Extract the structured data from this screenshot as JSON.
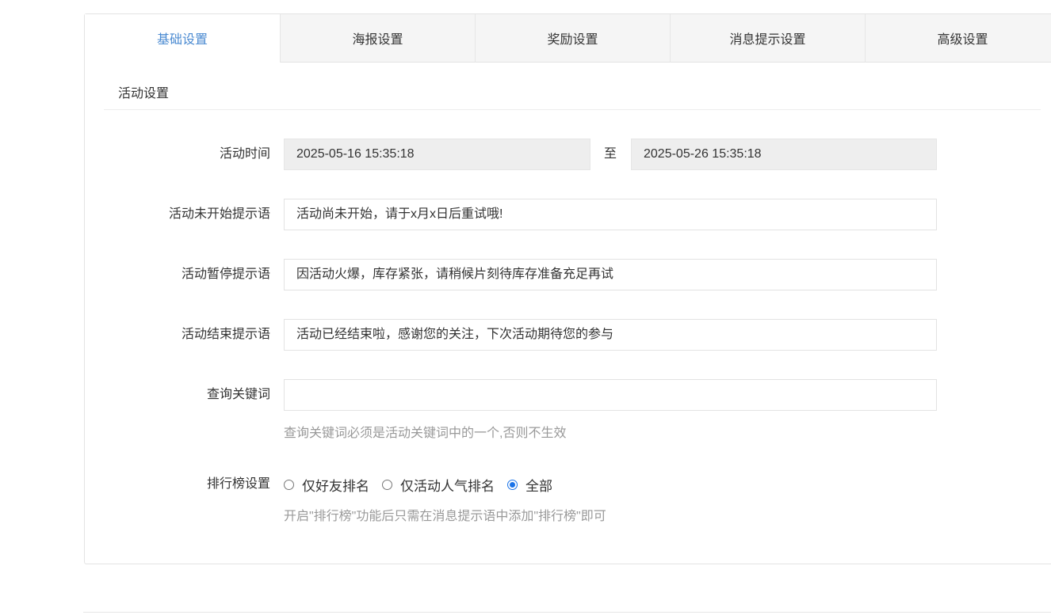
{
  "tabs": [
    {
      "label": "基础设置",
      "active": true
    },
    {
      "label": "海报设置",
      "active": false
    },
    {
      "label": "奖励设置",
      "active": false
    },
    {
      "label": "消息提示设置",
      "active": false
    },
    {
      "label": "高级设置",
      "active": false
    }
  ],
  "section": {
    "title": "活动设置"
  },
  "form": {
    "time": {
      "label": "活动时间",
      "start": "2025-05-16 15:35:18",
      "separator": "至",
      "end": "2025-05-26 15:35:18"
    },
    "not_started": {
      "label": "活动未开始提示语",
      "value": "活动尚未开始，请于x月x日后重试哦!"
    },
    "paused": {
      "label": "活动暂停提示语",
      "value": "因活动火爆，库存紧张，请稍候片刻待库存准备充足再试"
    },
    "ended": {
      "label": "活动结束提示语",
      "value": "活动已经结束啦，感谢您的关注，下次活动期待您的参与"
    },
    "keyword": {
      "label": "查询关键词",
      "value": "",
      "help": "查询关键词必须是活动关键词中的一个,否则不生效"
    },
    "ranking": {
      "label": "排行榜设置",
      "options": [
        {
          "label": "仅好友排名",
          "checked": false
        },
        {
          "label": "仅活动人气排名",
          "checked": false
        },
        {
          "label": "全部",
          "checked": true
        }
      ],
      "help": "开启\"排行榜\"功能后只需在消息提示语中添加\"排行榜\"即可"
    }
  },
  "colors": {
    "active_tab": "#4a8ad1",
    "radio_checked": "#1a73e8",
    "help_text": "#999999"
  }
}
